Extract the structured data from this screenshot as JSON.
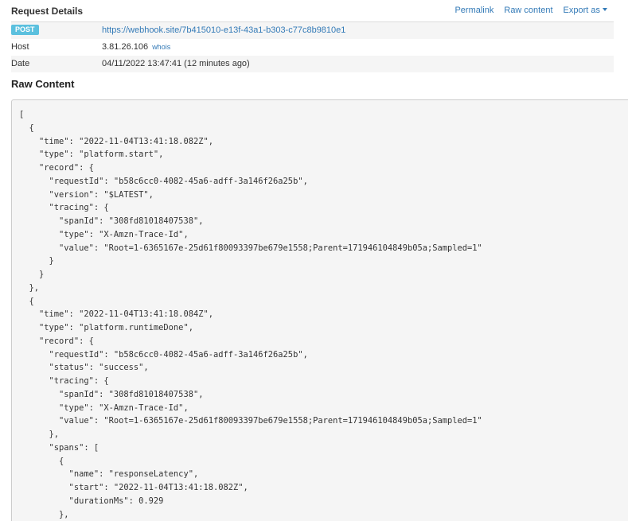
{
  "request_details": {
    "title": "Request Details",
    "links": {
      "permalink": "Permalink",
      "raw_content": "Raw content",
      "export_as": "Export as"
    },
    "method": "POST",
    "url": "https://webhook.site/7b415010-e13f-43a1-b303-c77c8b9810e1",
    "host_label": "Host",
    "host_ip": "3.81.26.106",
    "host_whois": "whois",
    "date_label": "Date",
    "date_value": "04/11/2022 13:47:41 (12 minutes ago)"
  },
  "raw_content": {
    "title": "Raw Content",
    "text": "[\n  {\n    \"time\": \"2022-11-04T13:41:18.082Z\",\n    \"type\": \"platform.start\",\n    \"record\": {\n      \"requestId\": \"b58c6cc0-4082-45a6-adff-3a146f26a25b\",\n      \"version\": \"$LATEST\",\n      \"tracing\": {\n        \"spanId\": \"308fd81018407538\",\n        \"type\": \"X-Amzn-Trace-Id\",\n        \"value\": \"Root=1-6365167e-25d61f80093397be679e1558;Parent=171946104849b05a;Sampled=1\"\n      }\n    }\n  },\n  {\n    \"time\": \"2022-11-04T13:41:18.084Z\",\n    \"type\": \"platform.runtimeDone\",\n    \"record\": {\n      \"requestId\": \"b58c6cc0-4082-45a6-adff-3a146f26a25b\",\n      \"status\": \"success\",\n      \"tracing\": {\n        \"spanId\": \"308fd81018407538\",\n        \"type\": \"X-Amzn-Trace-Id\",\n        \"value\": \"Root=1-6365167e-25d61f80093397be679e1558;Parent=171946104849b05a;Sampled=1\"\n      },\n      \"spans\": [\n        {\n          \"name\": \"responseLatency\",\n          \"start\": \"2022-11-04T13:41:18.082Z\",\n          \"durationMs\": 0.929\n        },"
  }
}
